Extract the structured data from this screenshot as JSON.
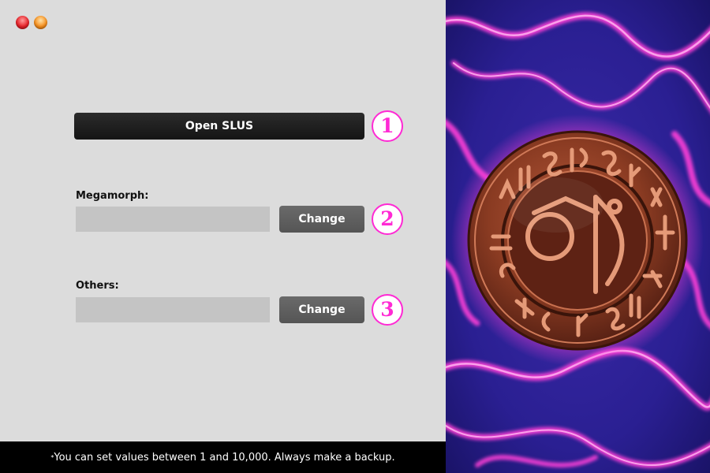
{
  "window": {
    "controls": [
      {
        "name": "close-button",
        "icon": "red-circle-icon",
        "color": "#e8232a"
      },
      {
        "name": "minimize-button",
        "icon": "orange-circle-icon",
        "color": "#f7901e"
      }
    ]
  },
  "actions": {
    "open_label": "Open SLUS",
    "step1": "1"
  },
  "megamorph": {
    "label": "Megamorph:",
    "value": "",
    "change_label": "Change",
    "step": "2"
  },
  "others": {
    "label": "Others:",
    "value": "",
    "change_label": "Change",
    "step": "3"
  },
  "footer": {
    "asterisk": "*",
    "note": "You can set values between 1 and 10,000. Always make a backup."
  },
  "artwork": {
    "subject": "bronze-rune-medallion-on-magenta-smoke",
    "colors": {
      "background": "#1d1a78",
      "smoke": "#ff3fd8",
      "medallion": "#8a3b22"
    }
  },
  "colors": {
    "accent": "#ff2ad4",
    "panel_bg": "#dcdcdc",
    "footer_bg": "#000000"
  }
}
